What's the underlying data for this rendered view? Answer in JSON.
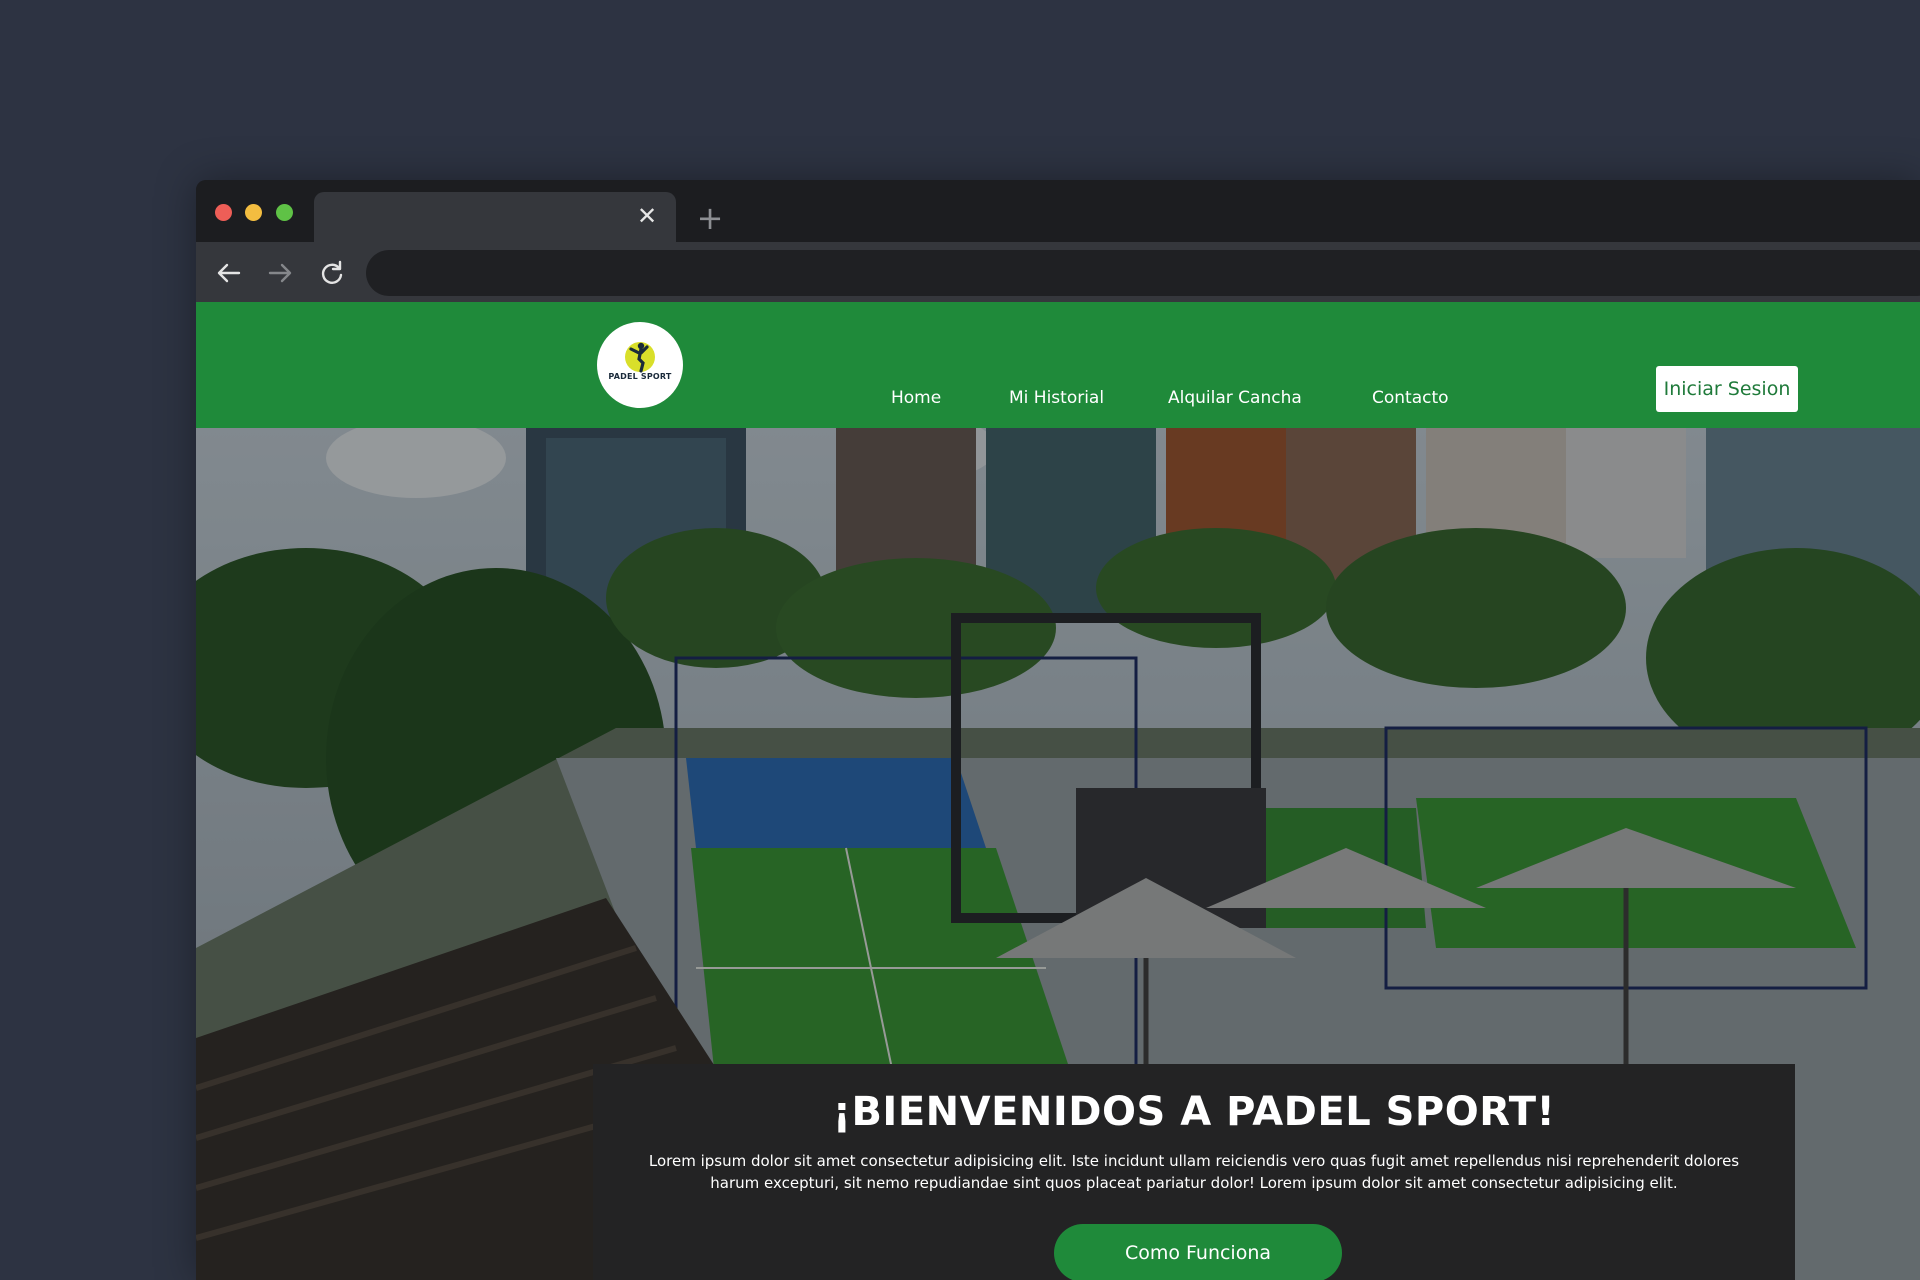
{
  "browser": {
    "tab": {
      "title": "",
      "close_glyph": "✕"
    },
    "new_tab_glyph": "+",
    "address_bar": {
      "value": ""
    },
    "icons": [
      "arrow-left-icon",
      "arrow-right-icon",
      "reload-icon"
    ]
  },
  "site": {
    "logo_text": "PADEL SPORT",
    "nav": [
      {
        "label": "Home"
      },
      {
        "label": "Mi Historial"
      },
      {
        "label": "Alquilar Cancha"
      },
      {
        "label": "Contacto"
      }
    ],
    "login_label": "Iniciar Sesion",
    "hero": {
      "title": "¡BIENVENIDOS A PADEL SPORT!",
      "text": "Lorem ipsum dolor sit amet consectetur adipisicing elit. Iste incidunt ullam reiciendis vero quas fugit amet repellendus nisi reprehenderit dolores harum excepturi, sit nemo repudiandae sint quos placeat pariatur dolor! Lorem ipsum dolor sit amet consectetur adipisicing elit.",
      "button_label": "Como Funciona"
    }
  },
  "colors": {
    "page_background": "#2d3342",
    "header_green": "#1f8a3a",
    "panel_dark": "#232324",
    "court_green": "#3d9a3a",
    "court_blue": "#2f6fb8"
  }
}
